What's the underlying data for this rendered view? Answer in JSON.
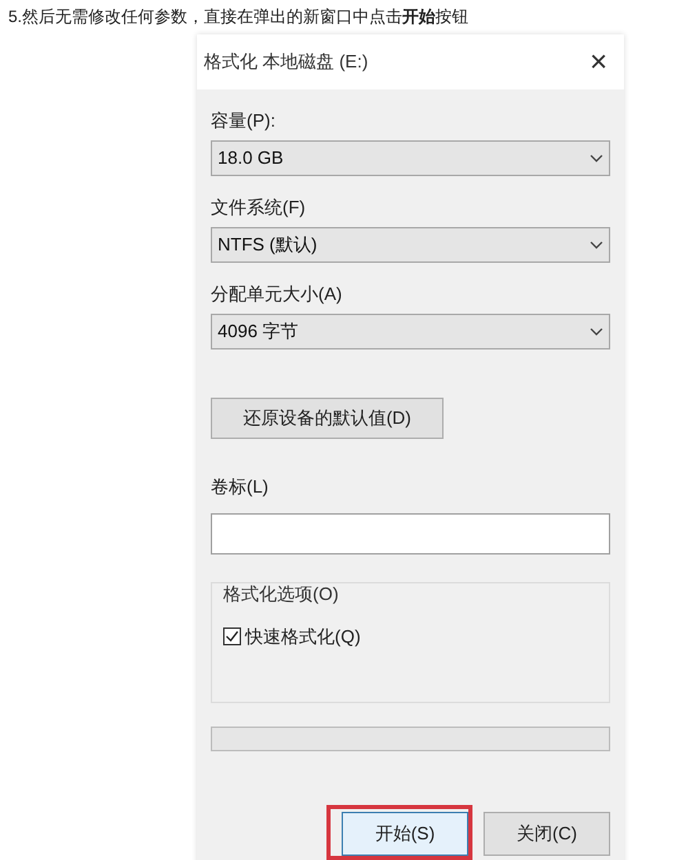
{
  "instruction": "5.然后无需修改任何参数，直接在弹出的新窗口中点击**开始**按钮",
  "dialog": {
    "title": "格式化 本地磁盘 (E:)",
    "close": "×",
    "fields": [
      {
        "label": "容量(P):",
        "value": "18.0 GB"
      },
      {
        "label": "文件系统(F)",
        "value": "NTFS (默认)"
      },
      {
        "label": "分配单元大小(A)",
        "value": "4096 字节"
      }
    ],
    "restore_button": "还原设备的默认值(D)",
    "volume_label": {
      "label": "卷标(L)"
    },
    "options_group": {
      "title": "格式化选项(O)",
      "options": [
        {
          "label": "快速格式化(Q)",
          "checked": true
        }
      ]
    },
    "progress": {
      "level": 0
    },
    "buttons": [
      {
        "label": "开始(S)",
        "highlighted": true
      },
      {
        "label": "关闭(C)",
        "highlighted": false
      }
    ]
  }
}
